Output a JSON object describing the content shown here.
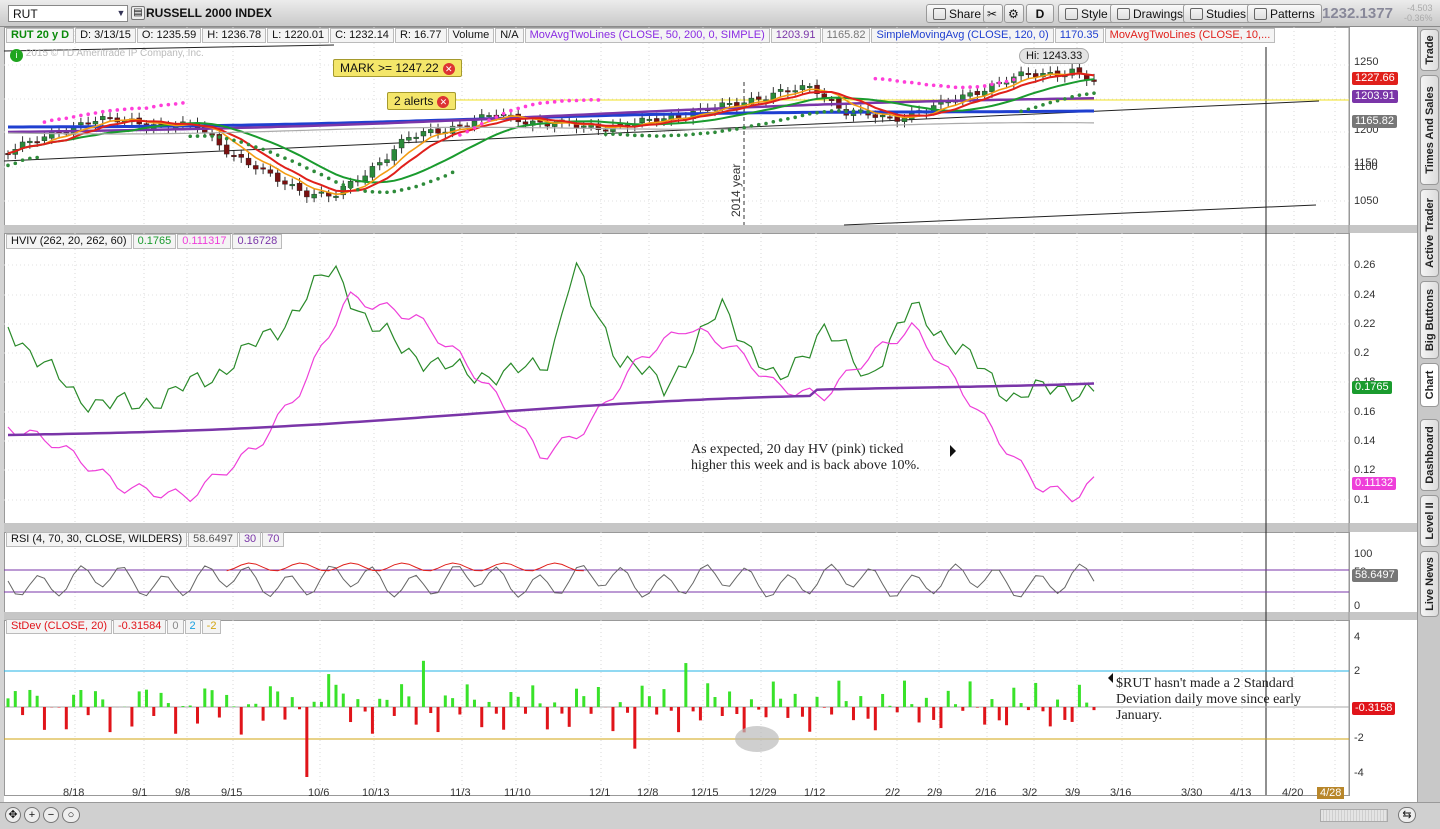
{
  "toolbar": {
    "symbol": "RUT",
    "title": "RUSSELL 2000 INDEX",
    "buttons": [
      "Share",
      "D",
      "Style",
      "Drawings",
      "Studies",
      "Patterns"
    ],
    "last_price": "1232.1377",
    "change_line1": "-4.503",
    "change_line2": "-0.36%"
  },
  "quote": {
    "symbol_period": "RUT 20 y D",
    "date": "D: 3/13/15",
    "open": "O: 1235.59",
    "high": "H: 1236.78",
    "low": "L: 1220.01",
    "close": "C: 1232.14",
    "range": "R: 16.77",
    "volume_label": "Volume",
    "volume_value": "N/A",
    "study1": "MovAvgTwoLines (CLOSE, 50, 200, 0, SIMPLE)",
    "study1_v1": "1203.91",
    "study1_v2": "1165.82",
    "study2": "SimpleMovingAvg (CLOSE, 120, 0)",
    "study2_v": "1170.35",
    "study3": "MovAvgTwoLines (CLOSE, 10,..."
  },
  "copyright": "2015 © TD Ameritrade IP Company, Inc.",
  "alerts": {
    "mark": "MARK >= 1247.22",
    "count": "2 alerts"
  },
  "hi_label": "Hi: 1243.33",
  "year_marker": "2014 year",
  "price_axis": [
    "1250",
    "1200",
    "1150",
    "1100",
    "1050"
  ],
  "price_tags": {
    "last": "1227.66",
    "ma50": "1203.91",
    "ma200": "1165.82"
  },
  "hviv": {
    "legend": "HVIV (262, 20, 262, 60)",
    "v1": "0.1765",
    "v2": "0.111317",
    "v3": "0.16728",
    "axis": [
      "0.26",
      "0.24",
      "0.22",
      "0.2",
      "0.18",
      "0.16",
      "0.14",
      "0.12",
      "0.1"
    ],
    "tag_green": "0.1765",
    "tag_pink": "0.11132",
    "note_line1": "As expected, 20 day HV (pink) ticked",
    "note_line2": "higher this week and is back above 10%."
  },
  "rsi": {
    "legend": "RSI (4, 70, 30, CLOSE, WILDERS)",
    "value": "58.6497",
    "lower": "30",
    "upper": "70",
    "axis": [
      "100",
      "50",
      "0"
    ],
    "tag": "58.6497"
  },
  "stdev": {
    "legend": "StDev (CLOSE, 20)",
    "value": "-0.31584",
    "l0": "0",
    "l1": "2",
    "l2": "-2",
    "axis": [
      "4",
      "2",
      "-2",
      "-4"
    ],
    "tag": "-0.3158",
    "note_line1": "$RUT hasn't made a 2 Standard",
    "note_line2": "Deviation daily move since early",
    "note_line3": "January."
  },
  "x_axis": [
    "8/18",
    "9/1",
    "9/8",
    "9/15",
    "10/6",
    "10/13",
    "11/3",
    "11/10",
    "12/1",
    "12/8",
    "12/15",
    "12/29",
    "1/12",
    "2/2",
    "2/9",
    "2/16",
    "3/2",
    "3/9",
    "3/16",
    "3/30",
    "4/13",
    "4/20",
    "4/28"
  ],
  "side_tabs": [
    "Trade",
    "Times And Sales",
    "Active Trader",
    "Big Buttons",
    "Chart",
    "Dashboard",
    "Level II",
    "Live News"
  ],
  "colors": {
    "ma_fast_red": "#e0201b",
    "ma_orange": "#f39c12",
    "ma_green": "#1a9b2e",
    "ma_purple": "#7a35a8",
    "ma_blue": "#1f3fd0",
    "dots_pink": "#ff3ed9",
    "dots_green": "#2e8b3a",
    "hv_pink": "#ee3fd9",
    "iv_green": "#2a8a2a",
    "bar_up": "#39e22a",
    "bar_down": "#e0141a"
  }
}
